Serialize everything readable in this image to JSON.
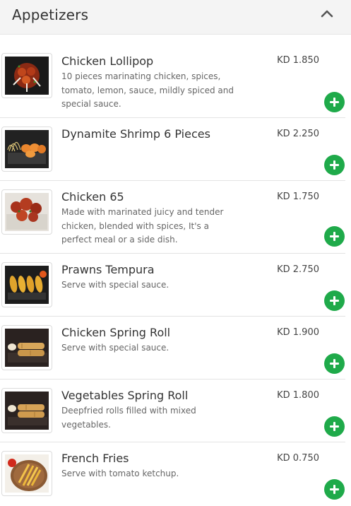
{
  "header": {
    "title": "Appetizers",
    "collapse_icon": "chevron-up-icon"
  },
  "items": [
    {
      "name": "Chicken Lollipop",
      "description": "10 pieces marinating chicken, spices, tomato, lemon, sauce, mildly spiced and special sauce.",
      "price": "KD 1.850"
    },
    {
      "name": "Dynamite Shrimp 6 Pieces",
      "description": "",
      "price": "KD 2.250"
    },
    {
      "name": "Chicken 65",
      "description": "Made with marinated juicy and tender chicken, blended with spices, It's a perfect meal or a side dish.",
      "price": "KD 1.750"
    },
    {
      "name": "Prawns Tempura",
      "description": "Serve with special sauce.",
      "price": "KD 2.750"
    },
    {
      "name": "Chicken Spring Roll",
      "description": "Serve with special sauce.",
      "price": "KD 1.900"
    },
    {
      "name": "Vegetables Spring Roll",
      "description": "Deepfried rolls filled with mixed vegetables.",
      "price": "KD 1.800"
    },
    {
      "name": "French Fries",
      "description": "Serve with tomato ketchup.",
      "price": "KD 0.750"
    }
  ],
  "add_icon": "plus-circle-icon"
}
